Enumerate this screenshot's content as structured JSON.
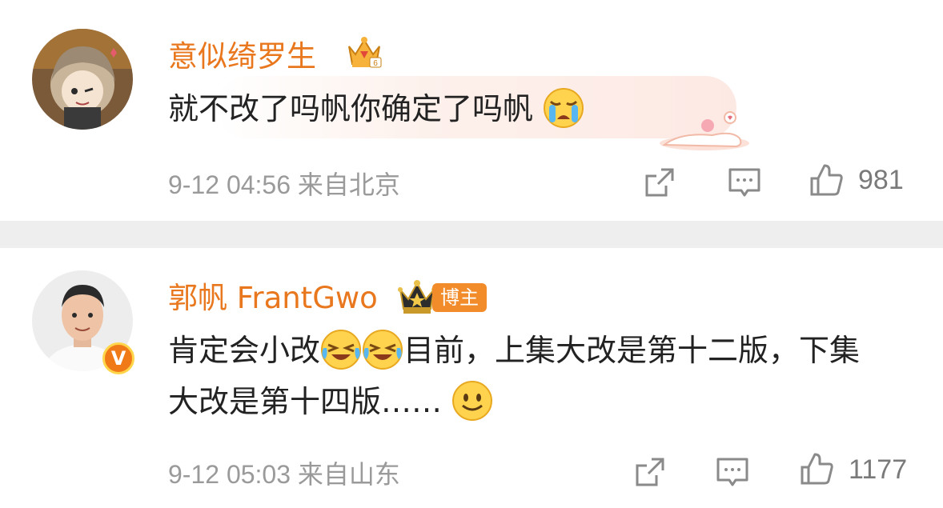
{
  "comments": [
    {
      "username": "意似绮罗生",
      "text": "就不改了吗帆你确定了吗帆",
      "timestamp": "9-12 04:56",
      "location": "来自北京",
      "likes": "981",
      "icons": [
        "crown-badge-icon",
        "crying-emoji-icon",
        "share-icon",
        "comment-icon",
        "like-icon"
      ]
    },
    {
      "username": "郭帆 FrantGwo",
      "badge": "博主",
      "text_part1": "肯定会小改",
      "text_part2": "目前，上集大改是第十二版，下集大改是第十四版……",
      "timestamp": "9-12 05:03",
      "location": "来自山东",
      "likes": "1177",
      "verified": "V",
      "icons": [
        "crown-badge-icon",
        "laughing-crying-emoji-icon",
        "smile-emoji-icon",
        "share-icon",
        "comment-icon",
        "like-icon"
      ]
    }
  ],
  "colors": {
    "username": "#e8771d",
    "meta": "#9a9a9a",
    "badge_bg": "#f28c2a",
    "separator": "#eeeeee"
  }
}
